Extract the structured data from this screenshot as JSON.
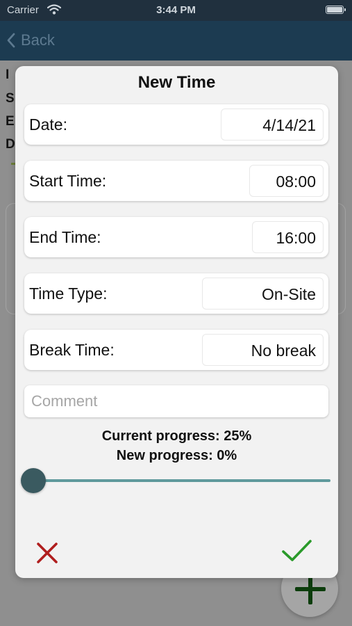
{
  "status_bar": {
    "carrier": "Carrier",
    "time": "3:44 PM"
  },
  "nav": {
    "back_label": "Back"
  },
  "background": {
    "partial_letters": [
      "I",
      "S",
      "E",
      "D"
    ]
  },
  "dialog": {
    "title": "New Time",
    "fields": [
      {
        "label": "Date:",
        "value": "4/14/21"
      },
      {
        "label": "Start Time:",
        "value": "08:00"
      },
      {
        "label": "End Time:",
        "value": "16:00"
      },
      {
        "label": "Time Type:",
        "value": "On-Site"
      },
      {
        "label": "Break Time:",
        "value": "No break"
      }
    ],
    "comment": {
      "placeholder": "Comment",
      "value": ""
    },
    "current_progress": "Current progress: 25%",
    "new_progress": "New progress: 0%",
    "slider_value": 0
  },
  "colors": {
    "nav_bar": "#1c3b51",
    "cancel": "#b01e1e",
    "confirm": "#2a9a2a",
    "slider_track": "#5f9a9c",
    "slider_thumb": "#3a5a60"
  },
  "icons": {
    "back": "chevron-left-icon",
    "cancel": "close-icon",
    "confirm": "checkmark-icon",
    "fab": "plus-icon"
  }
}
